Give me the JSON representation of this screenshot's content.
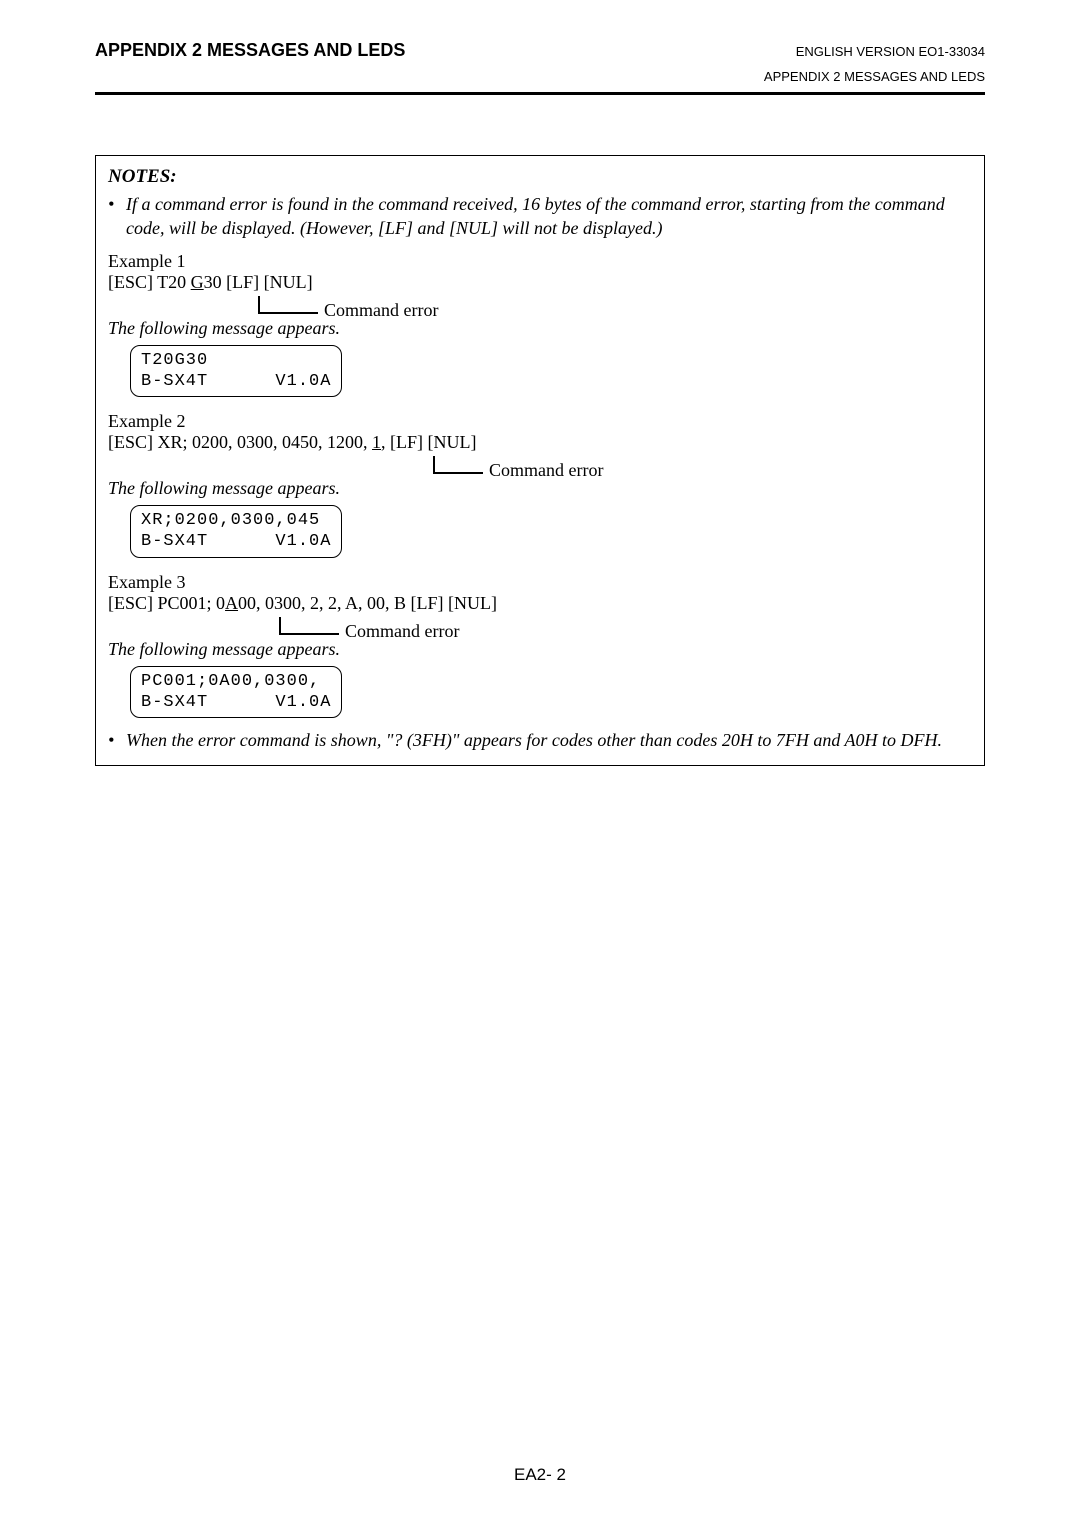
{
  "header": {
    "left": "APPENDIX 2  MESSAGES AND LEDS",
    "right": "ENGLISH VERSION EO1-33034",
    "sub": "APPENDIX 2  MESSAGES AND LEDS"
  },
  "notes": {
    "title": "NOTES:",
    "bullet1": "If a command error is found in the command received, 16 bytes of the command error, starting from the command code, will be displayed.  (However, [LF] and [NUL] will not be displayed.)",
    "bullet2": "When the error command is shown, \"? (3FH)\" appears for codes other than codes 20H to 7FH and A0H to DFH."
  },
  "ex1": {
    "label": "Example 1",
    "cmd_pre": "[ESC] T20 ",
    "cmd_err": "G",
    "cmd_post": "30 [LF] [NUL]",
    "callout": "Command error",
    "follow": "The following message appears.",
    "lcd1": "T20G30",
    "lcd2": "B-SX4T      V1.0A"
  },
  "ex2": {
    "label": "Example 2",
    "cmd_pre": "[ESC] XR; 0200, 0300, 0450, 1200, ",
    "cmd_err": "1",
    "cmd_post": ", [LF] [NUL]",
    "callout": "Command error",
    "follow": "The following message appears.",
    "lcd1": "XR;0200,0300,045",
    "lcd2": "B-SX4T      V1.0A"
  },
  "ex3": {
    "label": "Example 3",
    "cmd_pre": "[ESC] PC001; 0",
    "cmd_err": "A",
    "cmd_post": "00, 0300, 2, 2, A, 00, B [LF] [NUL]",
    "callout": "Command error",
    "follow": "The following message appears.",
    "lcd1": "PC001;0A00,0300,",
    "lcd2": "B-SX4T      V1.0A"
  },
  "page_number": "EA2- 2"
}
